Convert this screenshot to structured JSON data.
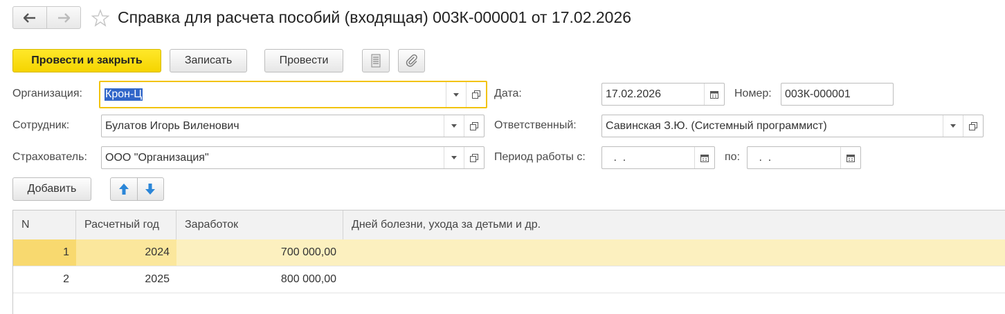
{
  "window": {
    "title": "Справка для расчета пособий (входящая) 003К-000001 от 17.02.2026"
  },
  "toolbar": {
    "post_close_label": "Провести и закрыть",
    "save_label": "Записать",
    "post_label": "Провести"
  },
  "form": {
    "organization": {
      "label": "Организация:",
      "value": "Крон-Ц"
    },
    "employee": {
      "label": "Сотрудник:",
      "value": "Булатов Игорь Виленович"
    },
    "insurer": {
      "label": "Страхователь:",
      "value": "ООО \"Организация\""
    },
    "date": {
      "label": "Дата:",
      "value": "17.02.2026"
    },
    "number": {
      "label": "Номер:",
      "value": "003К-000001"
    },
    "responsible": {
      "label": "Ответственный:",
      "value": "Савинская З.Ю. (Системный программист)"
    },
    "period": {
      "label_from": "Период работы с:",
      "value_from": " .  . ",
      "label_to": "по:",
      "value_to": " .  . "
    }
  },
  "table_toolbar": {
    "add_label": "Добавить"
  },
  "table": {
    "columns": [
      "N",
      "Расчетный год",
      "Заработок",
      "Дней болезни, ухода за детьми и др."
    ],
    "rows": [
      {
        "n": "1",
        "year": "2024",
        "earnings": "700 000,00",
        "days": ""
      },
      {
        "n": "2",
        "year": "2025",
        "earnings": "800 000,00",
        "days": ""
      }
    ]
  },
  "colors": {
    "accent_yellow": "#f5d400",
    "selected_row": "#fcf0bf",
    "focus_border": "#f2c300",
    "selection_blue": "#3166c9"
  }
}
